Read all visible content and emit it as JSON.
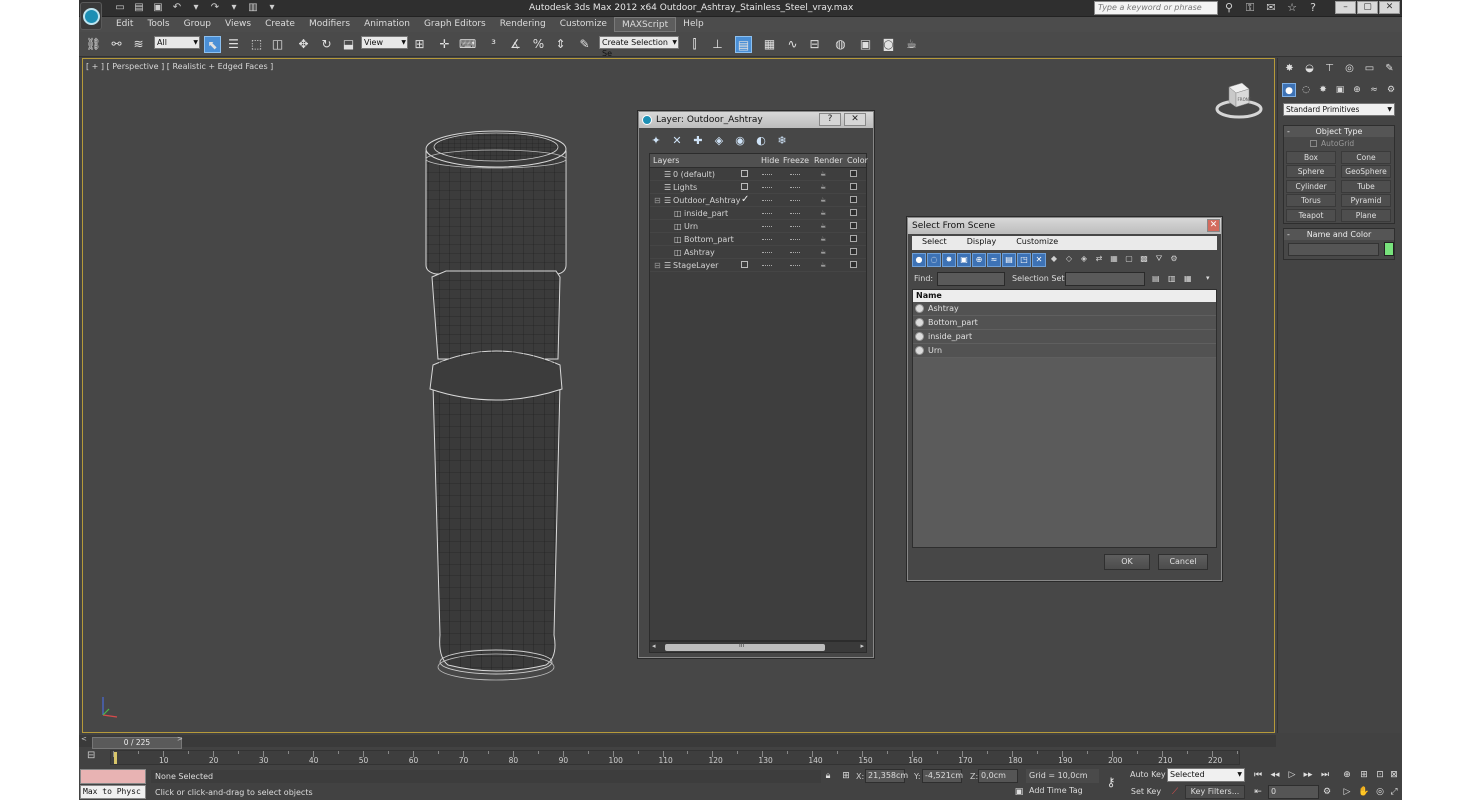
{
  "app": {
    "title": "Autodesk 3ds Max  2012 x64      Outdoor_Ashtray_Stainless_Steel_vray.max",
    "search_placeholder": "Type a keyword or phrase"
  },
  "menu": [
    "Edit",
    "Tools",
    "Group",
    "Views",
    "Create",
    "Modifiers",
    "Animation",
    "Graph Editors",
    "Rendering",
    "Customize",
    "MAXScript",
    "Help"
  ],
  "toolbar": {
    "filter_value": "All",
    "refcoord_value": "View",
    "named_selection_placeholder": "Create Selection Se"
  },
  "viewport": {
    "label": "[ + ] [ Perspective ] [ Realistic + Edged Faces ]",
    "viewcube_label": "FRONT"
  },
  "layer_dialog": {
    "title": "Layer: Outdoor_Ashtray",
    "help": "?",
    "close": "✕",
    "columns": [
      "Layers",
      "Hide",
      "Freeze",
      "Render",
      "Color"
    ],
    "rows": [
      {
        "name": "0 (default)",
        "indent": 0
      },
      {
        "name": "Lights",
        "indent": 0
      },
      {
        "name": "Outdoor_Ashtray",
        "indent": 0,
        "current": true
      },
      {
        "name": "inside_part",
        "indent": 1
      },
      {
        "name": "Urn",
        "indent": 1
      },
      {
        "name": "Bottom_part",
        "indent": 1
      },
      {
        "name": "Ashtray",
        "indent": 1
      },
      {
        "name": "StageLayer",
        "indent": 0
      }
    ],
    "current_mark": "✓",
    "scroll_grip": "III"
  },
  "select_dialog": {
    "title": "Select From Scene",
    "close": "✕",
    "menu": [
      "Select",
      "Display",
      "Customize"
    ],
    "find_label": "Find:",
    "selection_set_label": "Selection Set:",
    "list_header": "Name",
    "items": [
      "Ashtray",
      "Bottom_part",
      "inside_part",
      "Urn"
    ],
    "ok": "OK",
    "cancel": "Cancel"
  },
  "command_panel": {
    "category": "Standard Primitives",
    "object_type_title": "Object Type",
    "autogrid": "AutoGrid",
    "buttons": [
      "Box",
      "Cone",
      "Sphere",
      "GeoSphere",
      "Cylinder",
      "Tube",
      "Torus",
      "Pyramid",
      "Teapot",
      "Plane"
    ],
    "name_color_title": "Name and Color",
    "color": "#78e27c"
  },
  "timeline": {
    "slider": "0 / 225",
    "ticks": [
      10,
      20,
      30,
      40,
      50,
      60,
      70,
      80,
      90,
      100,
      110,
      120,
      130,
      140,
      150,
      160,
      170,
      180,
      190,
      200,
      210,
      220
    ]
  },
  "status": {
    "maxscript": "Max to Physc",
    "selection": "None Selected",
    "hint": "Click or click-and-drag to select objects",
    "x_label": "X:",
    "x_value": "21,358cm",
    "y_label": "Y:",
    "y_value": "-4,521cm",
    "z_label": "Z:",
    "z_value": "0,0cm",
    "grid": "Grid = 10,0cm",
    "add_time_tag": "Add Time Tag",
    "auto_key": "Auto Key",
    "auto_key_mode": "Selected",
    "set_key": "Set Key",
    "key_filters": "Key Filters...",
    "frame": "0"
  }
}
